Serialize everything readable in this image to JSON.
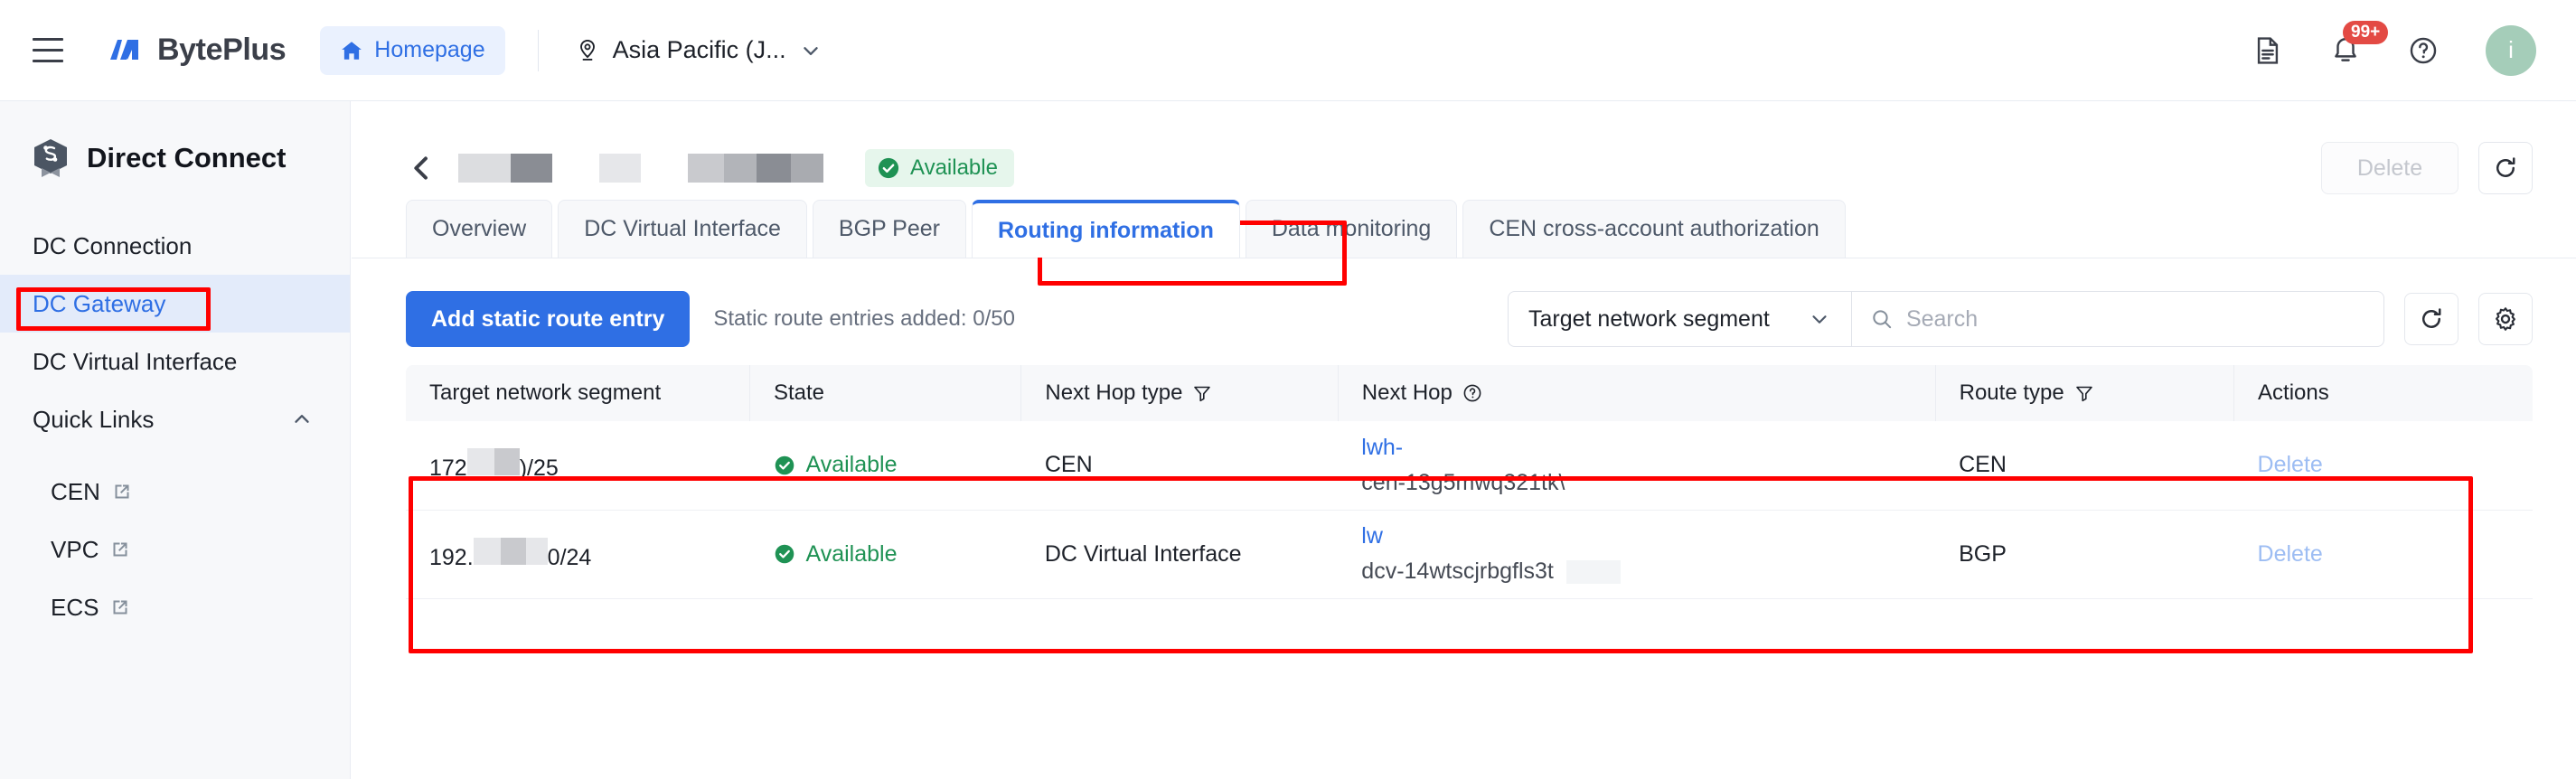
{
  "topnav": {
    "menu_icon": "hamburger-icon",
    "brand": "BytePlus",
    "homepage_label": "Homepage",
    "home_icon": "home-icon",
    "region_label": "Asia Pacific (J...",
    "region_icon": "location-pin-icon",
    "region_chevron": "chevron-down-icon",
    "docs_icon": "document-icon",
    "bell_icon": "bell-icon",
    "notification_badge": "99+",
    "help_icon": "question-circle-icon",
    "avatar_initial": "i",
    "avatar_color": "#a5cdb9",
    "badge_color": "#e34a44"
  },
  "sidebar": {
    "title": "Direct Connect",
    "product_icon": "direct-connect-hexagon-icon",
    "items": [
      {
        "label": "DC Connection",
        "active": false
      },
      {
        "label": "DC Gateway",
        "active": true
      },
      {
        "label": "DC Virtual Interface",
        "active": false
      }
    ],
    "group": {
      "label": "Quick Links",
      "chevron": "chevron-up-icon",
      "expanded": true
    },
    "quick_links": [
      {
        "label": "CEN",
        "icon": "external-link-icon"
      },
      {
        "label": "VPC",
        "icon": "external-link-icon"
      },
      {
        "label": "ECS",
        "icon": "external-link-icon"
      }
    ]
  },
  "page_header": {
    "back_icon": "chevron-left-icon",
    "title_redacted": true,
    "status": {
      "label": "Available",
      "icon": "check-circle-icon",
      "color": "#1f9254"
    },
    "delete_button": {
      "label": "Delete",
      "disabled": true
    },
    "refresh_icon": "refresh-icon"
  },
  "tabs": [
    {
      "label": "Overview",
      "active": false
    },
    {
      "label": "DC Virtual Interface",
      "active": false
    },
    {
      "label": "BGP Peer",
      "active": false
    },
    {
      "label": "Routing information",
      "active": true
    },
    {
      "label": "Data monitoring",
      "active": false
    },
    {
      "label": "CEN cross-account authorization",
      "active": false
    }
  ],
  "toolbar": {
    "add_button": "Add static route entry",
    "count_text": "Static route entries added: 0/50",
    "filter_select_value": "Target network segment",
    "filter_chevron": "chevron-down-icon",
    "search_icon": "search-icon",
    "search_value": "",
    "search_placeholder": "Search",
    "refresh_icon": "refresh-icon",
    "settings_icon": "gear-icon"
  },
  "table": {
    "columns": [
      {
        "label": "Target network segment",
        "filter": false,
        "help": false
      },
      {
        "label": "State",
        "filter": false,
        "help": false
      },
      {
        "label": "Next Hop type",
        "filter": true,
        "help": false
      },
      {
        "label": "Next Hop",
        "filter": false,
        "help": true
      },
      {
        "label": "Route type",
        "filter": true,
        "help": false
      },
      {
        "label": "Actions",
        "filter": false,
        "help": false
      }
    ],
    "rows": [
      {
        "segment_prefix": "172",
        "segment_suffix": ")/25",
        "state": "Available",
        "next_hop_type": "CEN",
        "next_hop_link": "lwh-",
        "next_hop_sub": "cen-13g5mwq321tk\\",
        "route_type": "CEN",
        "action": "Delete"
      },
      {
        "segment_prefix": "192.",
        "segment_suffix": "0/24",
        "state": "Available",
        "next_hop_type": "DC Virtual Interface",
        "next_hop_link": "lw",
        "next_hop_sub": "dcv-14wtscjrbgfls3t",
        "route_type": "BGP",
        "action": "Delete"
      }
    ]
  },
  "annotations": {
    "color": "#ff0000",
    "targets": [
      "sidebar-item-dc-gateway",
      "tab-routing-information",
      "table-rows"
    ]
  }
}
